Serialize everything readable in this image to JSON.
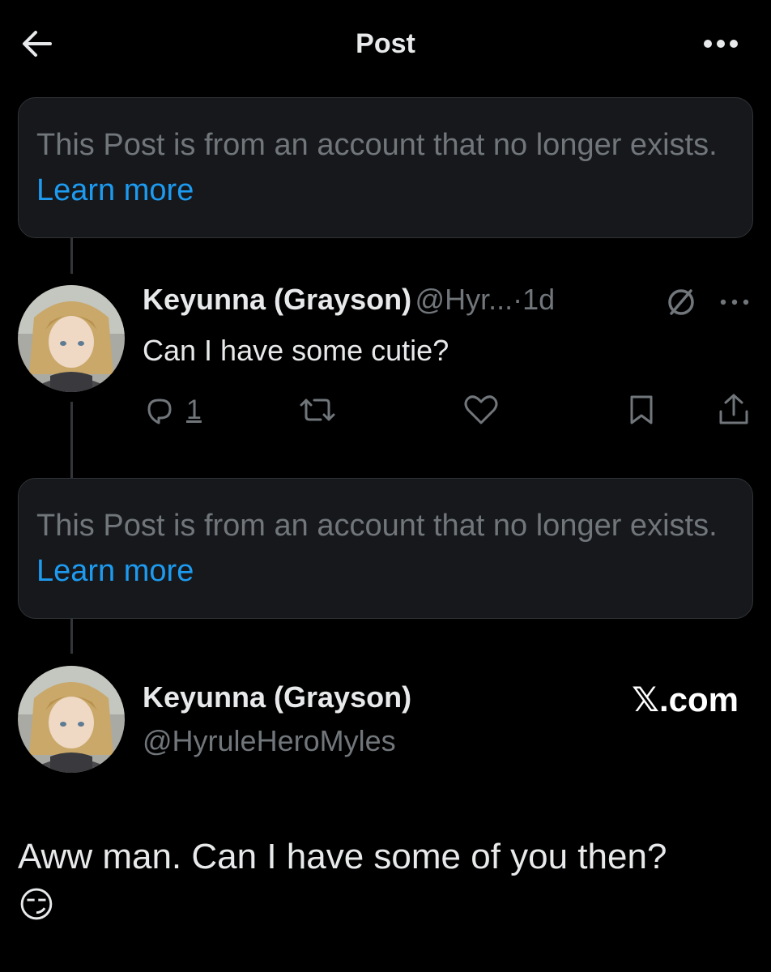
{
  "header": {
    "title": "Post",
    "back_icon": "arrow-left-icon",
    "more_icon": "more-horizontal-icon"
  },
  "notices": [
    {
      "text": "This Post is from an account that no longer exists.",
      "link": "Learn more"
    },
    {
      "text": "This Post is from an account that no longer exists.",
      "link": "Learn more"
    }
  ],
  "reply": {
    "name": "Keyunna (Grayson)",
    "handle": "@Hyr...",
    "separator": "·",
    "time": "1d",
    "text": "Can I have some cutie?",
    "reply_count": "1",
    "icons": [
      "no-sign-icon",
      "more-horizontal-icon",
      "reply-icon",
      "retweet-icon",
      "like-icon",
      "bookmark-icon",
      "share-icon"
    ]
  },
  "main_post": {
    "name": "Keyunna (Grayson)",
    "handle": "@HyruleHeroMyles",
    "watermark": "𝕏.com",
    "text": "Aww man. Can I have some of you then?",
    "emoji": "😏"
  },
  "colors": {
    "background": "#000000",
    "card": "#16181c",
    "link": "#1d9bf0",
    "muted": "#71767b",
    "text": "#e7e9ea"
  }
}
